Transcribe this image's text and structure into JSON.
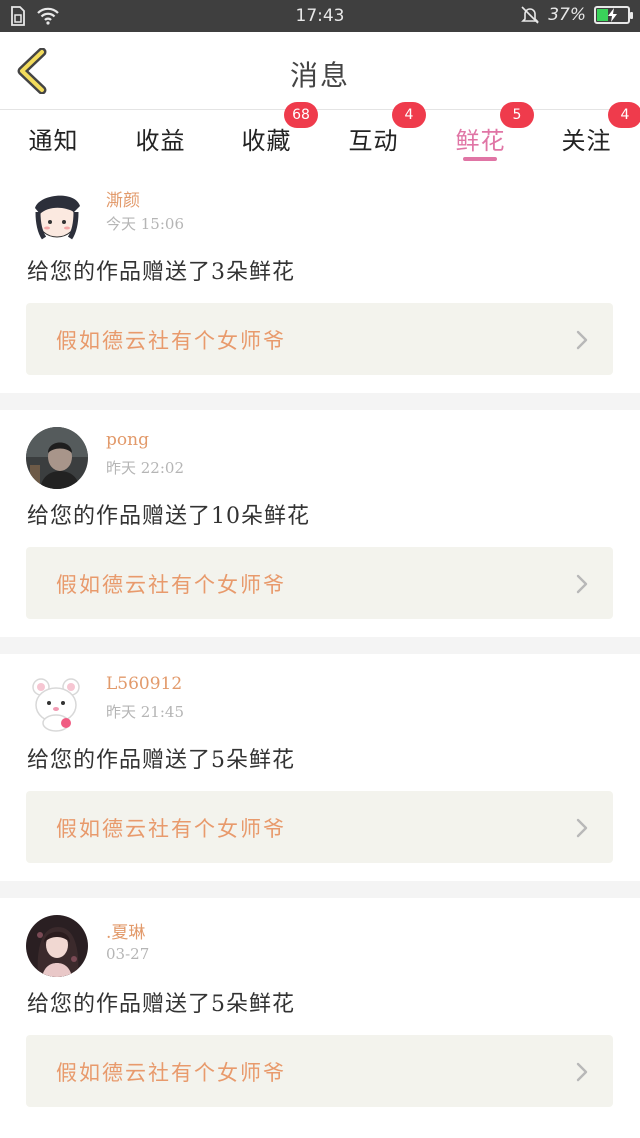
{
  "status_bar": {
    "time": "17:43",
    "battery_text": "37%",
    "battery_level": 0.37,
    "icons": [
      "sim-icon",
      "wifi-icon",
      "mute-bell-icon",
      "battery-icon"
    ]
  },
  "header": {
    "title": "消息",
    "back_icon": "back-chevron-icon"
  },
  "tabs": [
    {
      "label": "通知",
      "badge": ""
    },
    {
      "label": "收益",
      "badge": ""
    },
    {
      "label": "收藏",
      "badge": "68"
    },
    {
      "label": "互动",
      "badge": "4"
    },
    {
      "label": "鲜花",
      "badge": "5",
      "active": true
    },
    {
      "label": "关注",
      "badge": "4"
    }
  ],
  "colors": {
    "accent": "#e075a5",
    "badge": "#ef3b4c",
    "username": "#e29a6b",
    "work_title": "#e89a6c"
  },
  "items": [
    {
      "user": "澌颜",
      "time": "今天 15:06",
      "message": "给您的作品赠送了3朵鲜花",
      "work_title": "假如德云社有个女师爷"
    },
    {
      "user": "pong",
      "time": "昨天 22:02",
      "message": "给您的作品赠送了10朵鲜花",
      "work_title": "假如德云社有个女师爷"
    },
    {
      "user": "L560912",
      "time": "昨天 21:45",
      "message": "给您的作品赠送了5朵鲜花",
      "work_title": "假如德云社有个女师爷"
    },
    {
      "user": ".夏琳",
      "time": "03-27",
      "message": "给您的作品赠送了5朵鲜花",
      "work_title": "假如德云社有个女师爷"
    }
  ]
}
